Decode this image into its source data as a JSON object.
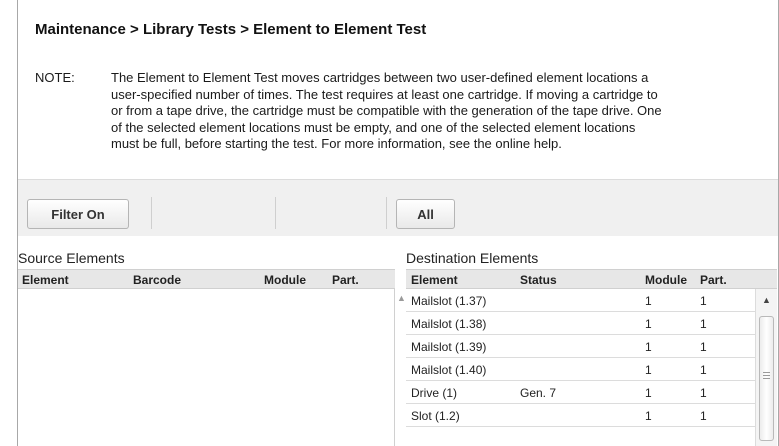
{
  "breadcrumb": "Maintenance > Library Tests > Element to Element Test",
  "note": {
    "label": "NOTE:",
    "lines": [
      "The Element to Element Test moves cartridges between two user-defined element locations a",
      "user-specified number of times. The test requires at least one cartridge. If moving a cartridge to",
      "or from a tape drive, the cartridge must be compatible with the generation of the tape drive. One",
      "of the selected element locations must be empty, and one of the selected element locations",
      "must be full, before starting the test. For more information, see the online help."
    ]
  },
  "toolbar": {
    "filter_label": "Filter On",
    "all_label": "All"
  },
  "source": {
    "title": "Source Elements",
    "columns": [
      "Element",
      "Barcode",
      "Module",
      "Part."
    ],
    "rows": []
  },
  "destination": {
    "title": "Destination Elements",
    "columns": [
      "Element",
      "Status",
      "Module",
      "Part."
    ],
    "rows": [
      {
        "element": "Mailslot (1.37)",
        "status": "",
        "module": "1",
        "part": "1"
      },
      {
        "element": "Mailslot (1.38)",
        "status": "",
        "module": "1",
        "part": "1"
      },
      {
        "element": "Mailslot (1.39)",
        "status": "",
        "module": "1",
        "part": "1"
      },
      {
        "element": "Mailslot (1.40)",
        "status": "",
        "module": "1",
        "part": "1"
      },
      {
        "element": "Drive (1)",
        "status": "Gen. 7",
        "module": "1",
        "part": "1"
      },
      {
        "element": "Slot (1.2)",
        "status": "",
        "module": "1",
        "part": "1"
      }
    ]
  },
  "icons": {
    "scroll_up": "arrow-up-icon",
    "scroll_grip": "grip-icon"
  }
}
